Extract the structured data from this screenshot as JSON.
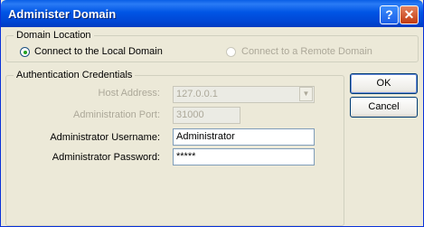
{
  "window": {
    "title": "Administer Domain"
  },
  "titlebar": {
    "help_glyph": "?",
    "close_glyph": "✕"
  },
  "domain_location": {
    "legend": "Domain Location",
    "local_label": "Connect to the Local Domain",
    "remote_label": "Connect to a Remote Domain",
    "selected": "local"
  },
  "auth": {
    "legend": "Authentication Credentials",
    "host_label": "Host Address:",
    "host_value": "127.0.0.1",
    "port_label": "Administration Port:",
    "port_value": "31000",
    "user_label": "Administrator Username:",
    "user_value": "Administrator",
    "pass_label": "Administrator Password:",
    "pass_value": "*****"
  },
  "buttons": {
    "ok": "OK",
    "cancel": "Cancel"
  },
  "colors": {
    "titlebar": "#0055e5",
    "dialog_bg": "#ece9d8",
    "radio_dot": "#21a121"
  }
}
